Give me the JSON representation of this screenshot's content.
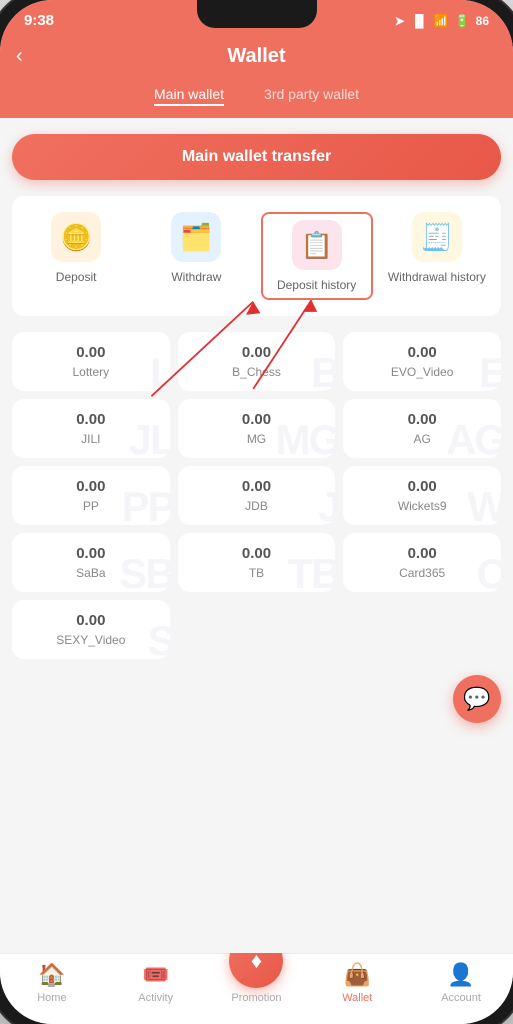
{
  "statusBar": {
    "time": "9:38",
    "battery": "86"
  },
  "header": {
    "title": "Wallet",
    "backLabel": "‹"
  },
  "walletTabs": [
    {
      "id": "main",
      "label": "Main wallet",
      "active": true
    },
    {
      "id": "third",
      "label": "3rd party wallet",
      "active": false
    }
  ],
  "transferButton": {
    "label": "Main wallet transfer"
  },
  "actions": [
    {
      "id": "deposit",
      "icon": "🪙",
      "label": "Deposit",
      "highlighted": false
    },
    {
      "id": "withdraw",
      "icon": "🗂️",
      "label": "Withdraw",
      "highlighted": false
    },
    {
      "id": "deposit-history",
      "icon": "📋",
      "label": "Deposit\nhistory",
      "highlighted": true
    },
    {
      "id": "withdrawal-history",
      "icon": "🧾",
      "label": "Withdrawal\nhistory",
      "highlighted": false
    }
  ],
  "walletCards": [
    {
      "id": "lottery",
      "amount": "0.00",
      "label": "Lottery",
      "watermark": "L"
    },
    {
      "id": "chess",
      "amount": "0.00",
      "label": "B_Chess",
      "watermark": "B"
    },
    {
      "id": "evo-video",
      "amount": "0.00",
      "label": "EVO_Video",
      "watermark": "E"
    },
    {
      "id": "jili",
      "amount": "0.00",
      "label": "JILI",
      "watermark": "JL"
    },
    {
      "id": "mg",
      "amount": "0.00",
      "label": "MG",
      "watermark": "MG"
    },
    {
      "id": "ag",
      "amount": "0.00",
      "label": "AG",
      "watermark": "A"
    },
    {
      "id": "pp",
      "amount": "0.00",
      "label": "PP",
      "watermark": "PP"
    },
    {
      "id": "jdb",
      "amount": "0.00",
      "label": "JDB",
      "watermark": "J"
    },
    {
      "id": "wickets9",
      "amount": "0.00",
      "label": "Wickets9",
      "watermark": "W"
    },
    {
      "id": "saba",
      "amount": "0.00",
      "label": "SaBa",
      "watermark": "SB"
    },
    {
      "id": "tb",
      "amount": "0.00",
      "label": "TB",
      "watermark": "TB"
    },
    {
      "id": "card365",
      "amount": "0.00",
      "label": "Card365",
      "watermark": "C"
    },
    {
      "id": "sexy-video",
      "amount": "0.00",
      "label": "SEXY_Video",
      "watermark": "S"
    }
  ],
  "bottomNav": [
    {
      "id": "home",
      "icon": "🏠",
      "label": "Home",
      "active": false
    },
    {
      "id": "activity",
      "icon": "🎟️",
      "label": "Activity",
      "active": false
    },
    {
      "id": "promotion",
      "icon": "♦",
      "label": "Promotion",
      "active": false,
      "center": true
    },
    {
      "id": "wallet",
      "icon": "👜",
      "label": "Wallet",
      "active": true
    },
    {
      "id": "account",
      "icon": "👤",
      "label": "Account",
      "active": false
    }
  ]
}
